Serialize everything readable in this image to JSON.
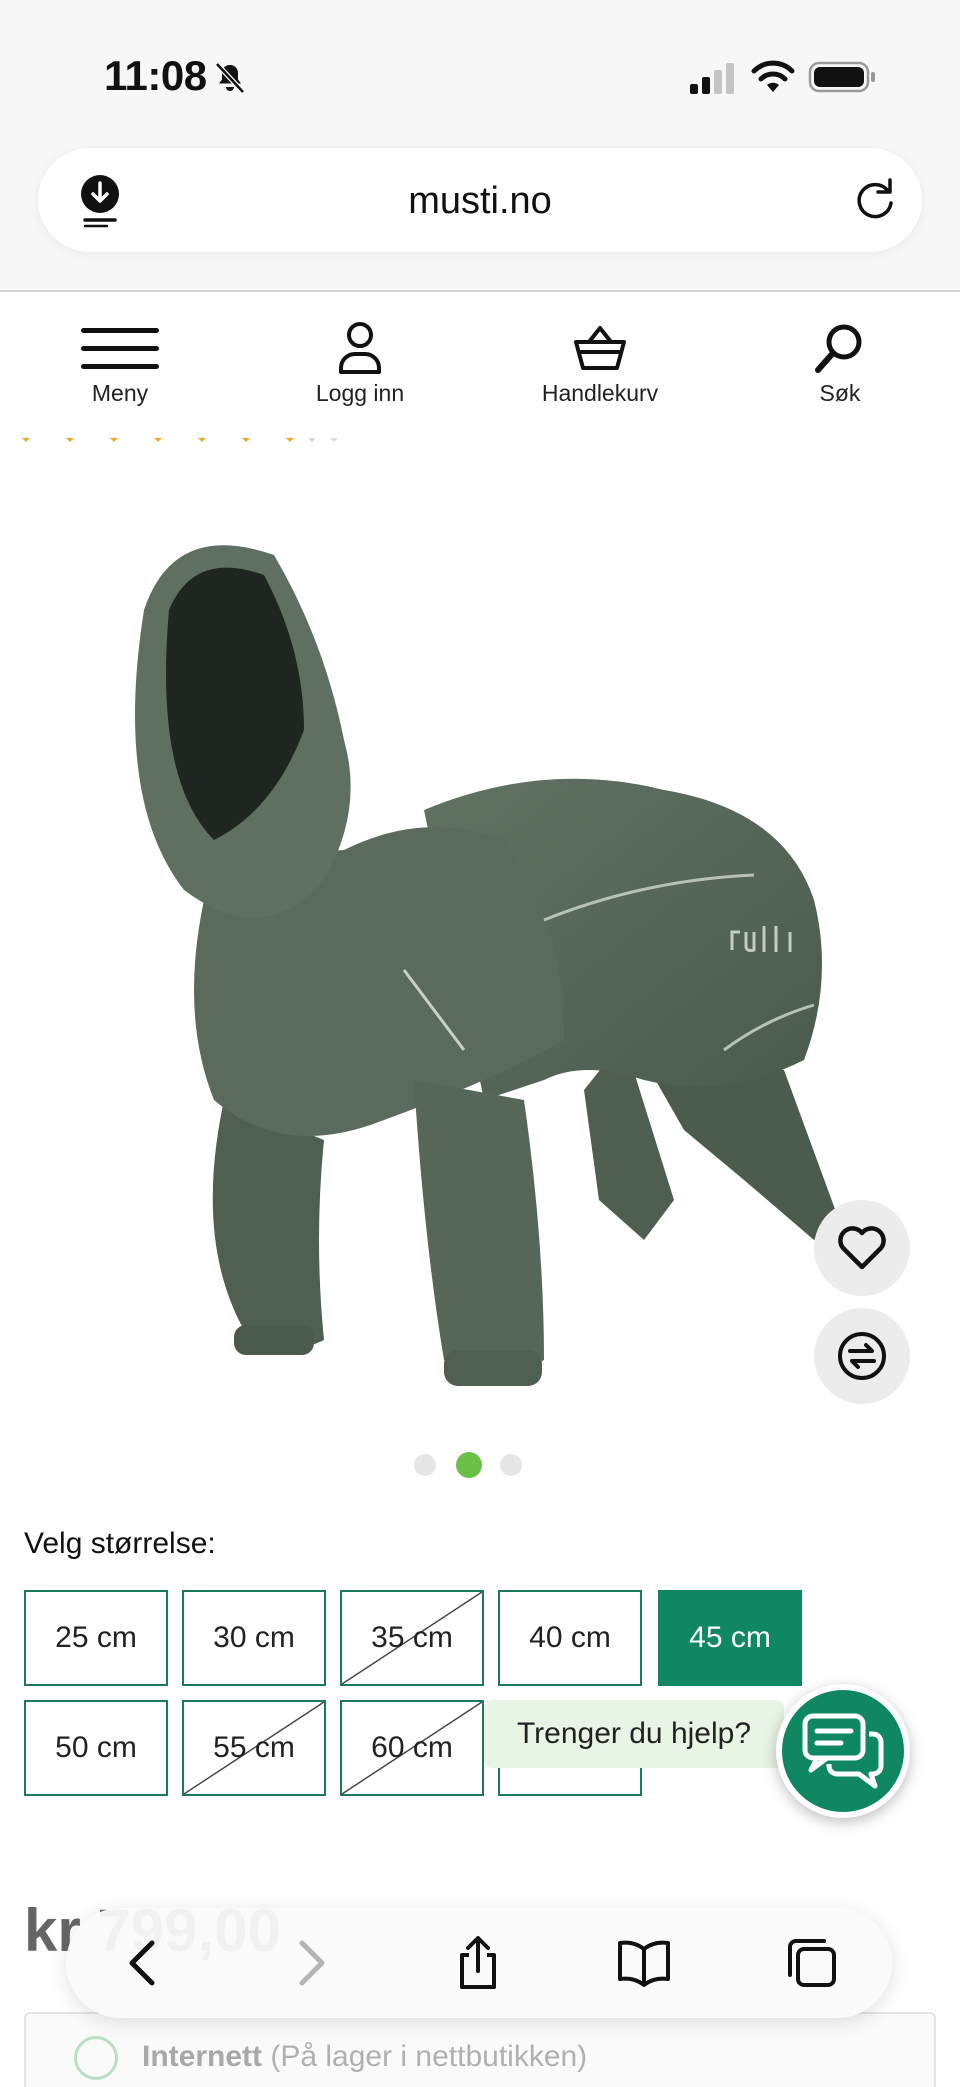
{
  "status_bar": {
    "time": "11:08"
  },
  "browser": {
    "url": "musti.no"
  },
  "nav": {
    "menu_label": "Meny",
    "login_label": "Logg inn",
    "cart_label": "Handlekurv",
    "search_label": "Søk"
  },
  "gallery": {
    "image_count": 3,
    "active_index": 1
  },
  "sizes": {
    "heading": "Velg størrelse:",
    "options": [
      {
        "label": "25 cm",
        "available": true,
        "selected": false
      },
      {
        "label": "30 cm",
        "available": true,
        "selected": false
      },
      {
        "label": "35 cm",
        "available": false,
        "selected": false
      },
      {
        "label": "40 cm",
        "available": true,
        "selected": false
      },
      {
        "label": "45 cm",
        "available": true,
        "selected": true
      },
      {
        "label": "50 cm",
        "available": true,
        "selected": false
      },
      {
        "label": "55 cm",
        "available": false,
        "selected": false
      },
      {
        "label": "60 cm",
        "available": false,
        "selected": false
      }
    ]
  },
  "help": {
    "label": "Trenger du hjelp?"
  },
  "price": {
    "text": "kr 799,00"
  },
  "stock": {
    "channel": "Internett",
    "note": "(På lager i nettbutikken)"
  },
  "colors": {
    "accent": "#0f8763",
    "active_dot": "#6cc04a",
    "jacket": "#56685a"
  }
}
